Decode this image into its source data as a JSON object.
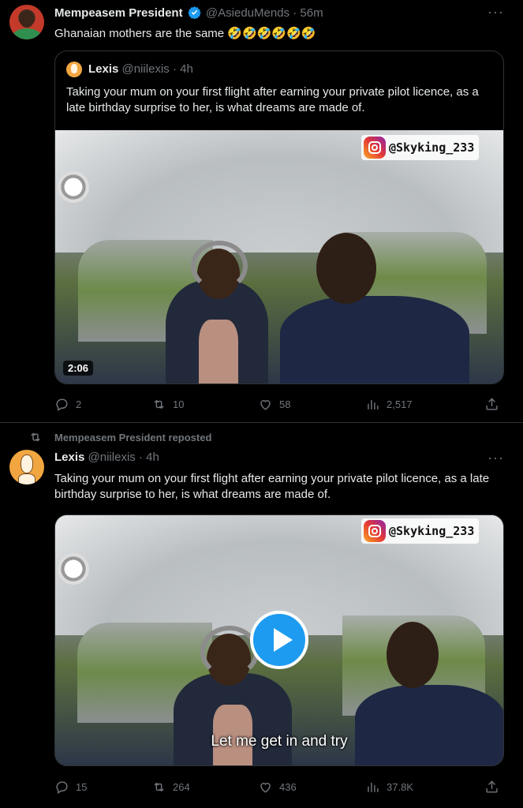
{
  "tweet_main": {
    "author_name": "Mempeasem President",
    "author_handle": "@AsieduMends",
    "time": "56m",
    "text": "Ghanaian mothers are the same 🤣🤣🤣🤣🤣🤣",
    "quote": {
      "author_name": "Lexis",
      "author_handle": "@niilexis",
      "time": "4h",
      "text": "Taking your mum on your first flight after earning your private pilot licence, as a late birthday surprise to her, is what dreams are made of.",
      "video": {
        "watermark": "@Skyking_233",
        "duration": "2:06"
      }
    },
    "stats": {
      "replies": "2",
      "reposts": "10",
      "likes": "58",
      "views": "2,517"
    }
  },
  "tweet_repost": {
    "reposted_by": "Mempeasem President reposted",
    "author_name": "Lexis",
    "author_handle": "@niilexis",
    "time": "4h",
    "text": "Taking your mum on your first flight after earning your private pilot licence, as a late birthday surprise to her, is what dreams are made of.",
    "video": {
      "watermark": "@Skyking_233",
      "caption": "Let me get in and try"
    },
    "stats": {
      "replies": "15",
      "reposts": "264",
      "likes": "436",
      "views": "37.8K"
    }
  },
  "colors": {
    "background": "#000000",
    "text": "#e7e9ea",
    "muted": "#71767b",
    "border": "#2f3336",
    "verified": "#1d9bf0",
    "play_button": "#1d9bf0"
  },
  "icons": {
    "reply": "reply-icon",
    "repost": "repost-icon",
    "like": "heart-icon",
    "views": "views-bar-chart-icon",
    "share": "share-icon",
    "more": "more-dots-icon",
    "verified": "verified-badge-icon"
  }
}
